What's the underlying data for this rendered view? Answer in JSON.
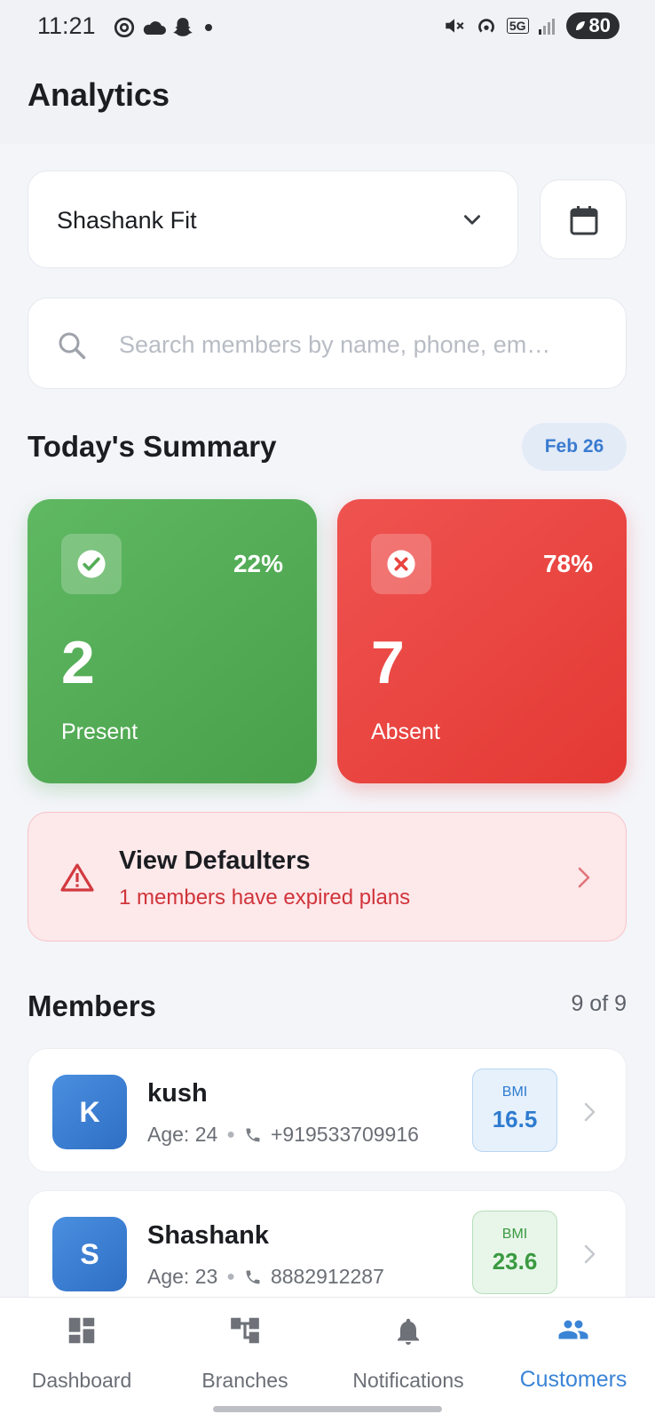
{
  "status_bar": {
    "time": "11:21",
    "battery": "80",
    "network": "5G"
  },
  "header": {
    "title": "Analytics"
  },
  "gym_selector": {
    "value": "Shashank Fit"
  },
  "search": {
    "placeholder": "Search members by name, phone, em…"
  },
  "summary": {
    "title": "Today's Summary",
    "date": "Feb 26",
    "present": {
      "count": "2",
      "label": "Present",
      "percent": "22%",
      "color": "#4caf50"
    },
    "absent": {
      "count": "7",
      "label": "Absent",
      "percent": "78%",
      "color": "#e53935"
    }
  },
  "defaulters": {
    "title": "View Defaulters",
    "subtitle": "1 members have expired plans"
  },
  "members": {
    "title": "Members",
    "count": "9 of 9",
    "items": [
      {
        "initial": "K",
        "name": "kush",
        "age": "Age: 24",
        "phone": "+919533709916",
        "bmi_label": "BMI",
        "bmi": "16.5",
        "bmi_color": "blue"
      },
      {
        "initial": "S",
        "name": "Shashank",
        "age": "Age: 23",
        "phone": "8882912287",
        "bmi_label": "BMI",
        "bmi": "23.6",
        "bmi_color": "green"
      }
    ]
  },
  "nav": {
    "items": [
      {
        "label": "Dashboard",
        "icon": "dashboard-icon"
      },
      {
        "label": "Branches",
        "icon": "branches-icon"
      },
      {
        "label": "Notifications",
        "icon": "bell-icon"
      },
      {
        "label": "Customers",
        "icon": "people-icon",
        "active": true
      }
    ]
  },
  "colors": {
    "accent": "#3a84d6",
    "present": "#4caf50",
    "absent": "#e53935",
    "danger_bg": "#fde8ea"
  }
}
